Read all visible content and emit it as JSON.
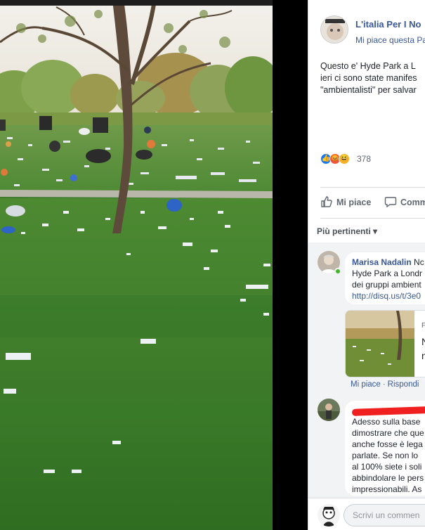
{
  "post": {
    "page_name": "L'italia Per I No",
    "page_like": "Mi piace questa Pa",
    "text_lines": [
      "Questo e' Hyde Park a L",
      "ieri ci sono state manifes",
      "\"ambientalisti\" per salvar"
    ],
    "reaction_count": "378",
    "actions": {
      "like": "Mi piace",
      "comment": "Comm"
    },
    "relevance": "Più pertinenti ▾"
  },
  "comments": [
    {
      "author": "Marisa Nadalin",
      "author_suffix": " Nc",
      "lines": [
        "Hyde Park a Londr",
        "dei gruppi ambient"
      ],
      "link": "http://disq.us/t/3e0",
      "card_lines": [
        "F",
        "N",
        "n"
      ],
      "like": "Mi piace",
      "reply": "Rispondi"
    },
    {
      "author": "",
      "lines": [
        "Adesso sulla base",
        "dimostrare che que",
        "anche fosse è lega",
        "parlate. Se non lo",
        "al 100% siete i soli",
        "abbindolare le pers",
        "impressionabili. As"
      ]
    }
  ],
  "compose": {
    "placeholder": "Scrivi un commen"
  },
  "colors": {
    "link": "#385898",
    "like_blue": "#1877f2",
    "angry": "#f0533e",
    "haha": "#f7b125",
    "redaction": "#f02020"
  }
}
